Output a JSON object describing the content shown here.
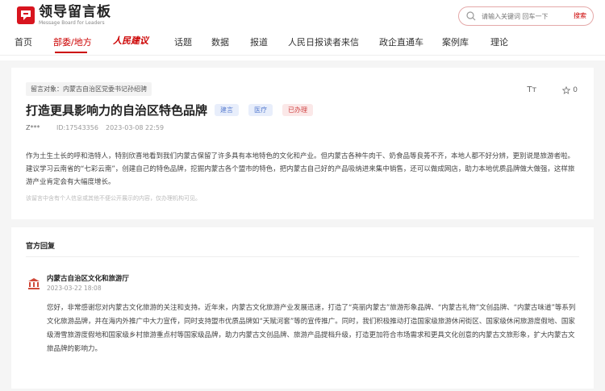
{
  "header": {
    "logo_cn": "领导留言板",
    "logo_en": "Message Board for Leaders",
    "search_placeholder": "请输入关键词 回车一下",
    "search_button": "搜索"
  },
  "nav": {
    "items": [
      {
        "label": "首页"
      },
      {
        "label": "部委/地方"
      },
      {
        "label": "人民建议"
      },
      {
        "label": "话题"
      },
      {
        "label": "数据"
      },
      {
        "label": "报道"
      },
      {
        "label": "人民日报读者来信"
      },
      {
        "label": "政企直通车"
      },
      {
        "label": "案例库"
      },
      {
        "label": "理论"
      }
    ]
  },
  "message": {
    "target": "留言对象：内蒙古自治区党委书记孙绍骋",
    "font_toggle": "Tт",
    "favorites": "0",
    "title": "打造更具影响力的自治区特色品牌",
    "tags": [
      "建言",
      "医疗",
      "已办理"
    ],
    "user": "Z***",
    "id": "ID:17543356",
    "time": "2023-03-08 22:59",
    "content": "作为土生土长的呼和浩特人，特别欣喜地看到我们内蒙古保留了许多具有本地特色的文化和产业。但内蒙古各种牛肉干、奶食品等良莠不齐，本地人都不好分辨，更别说是旅游者啦。建议学习云南省的“七彩云南”，创建自己的特色品牌，挖掘内蒙古各个盟市的特色，把内蒙古自己好的产品吸纳进来集中销售，还可以做成网店，助力本地优质品牌做大做强，这样旅游产业肯定会有大幅度增长。",
    "disclaimer": "该留言中含有个人信息或其他不便公开展示的内容，仅办理机构可见。"
  },
  "reply": {
    "section_title": "官方回复",
    "dept": "内蒙古自治区文化和旅游厅",
    "time": "2023-03-22 18:08",
    "text": "您好，非常感谢您对内蒙古文化旅游的关注和支持。近年来，内蒙古文化旅游产业发展迅速，打造了“亮丽内蒙古”旅游形象品牌、“内蒙古礼物”文创品牌、“内蒙古味道”等系列文化旅游品牌，并在海内外推广中大力宣传，同时支持盟市优质品牌如“天赋河套”等的宣传推广。同时，我们积极推动打造国家级旅游休闲街区、国家级休闲旅游度假地、国家级滑雪旅游度假地和国家级乡村旅游重点村等国家级品牌，助力内蒙古文创品牌、旅游产品提档升级，打造更加符合市场需求和更具文化创意的内蒙古文旅形象，扩大内蒙古文旅品牌的影响力。"
  },
  "colors": {
    "accent": "#cc0000"
  }
}
